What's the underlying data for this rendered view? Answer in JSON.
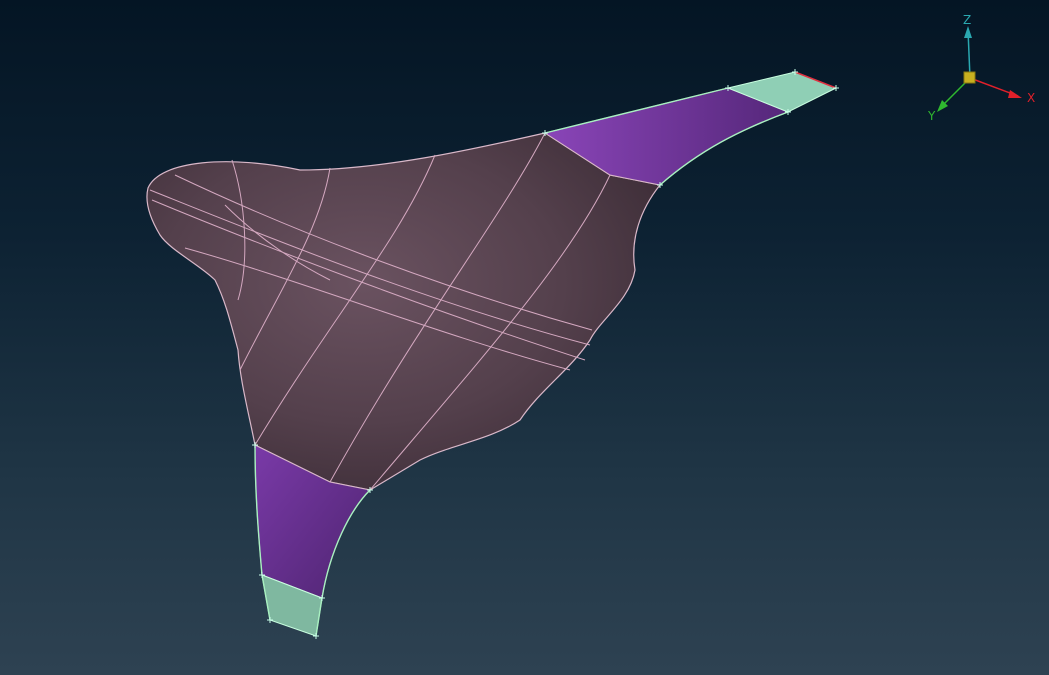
{
  "viewport": {
    "background_top": "#041524",
    "background_bottom": "#2e4252"
  },
  "model": {
    "body_color": "#5a4450",
    "edge_color": "#d9b8c9",
    "transition_color": "#6a3590",
    "cap_color": "#8fcfb5",
    "boundary_color": "#a8f0c0"
  },
  "triad": {
    "x_label": "X",
    "y_label": "Y",
    "z_label": "Z",
    "x_color": "#e0202a",
    "y_color": "#2fb82f",
    "z_color": "#2aa8b0",
    "origin_color": "#c8b020"
  }
}
